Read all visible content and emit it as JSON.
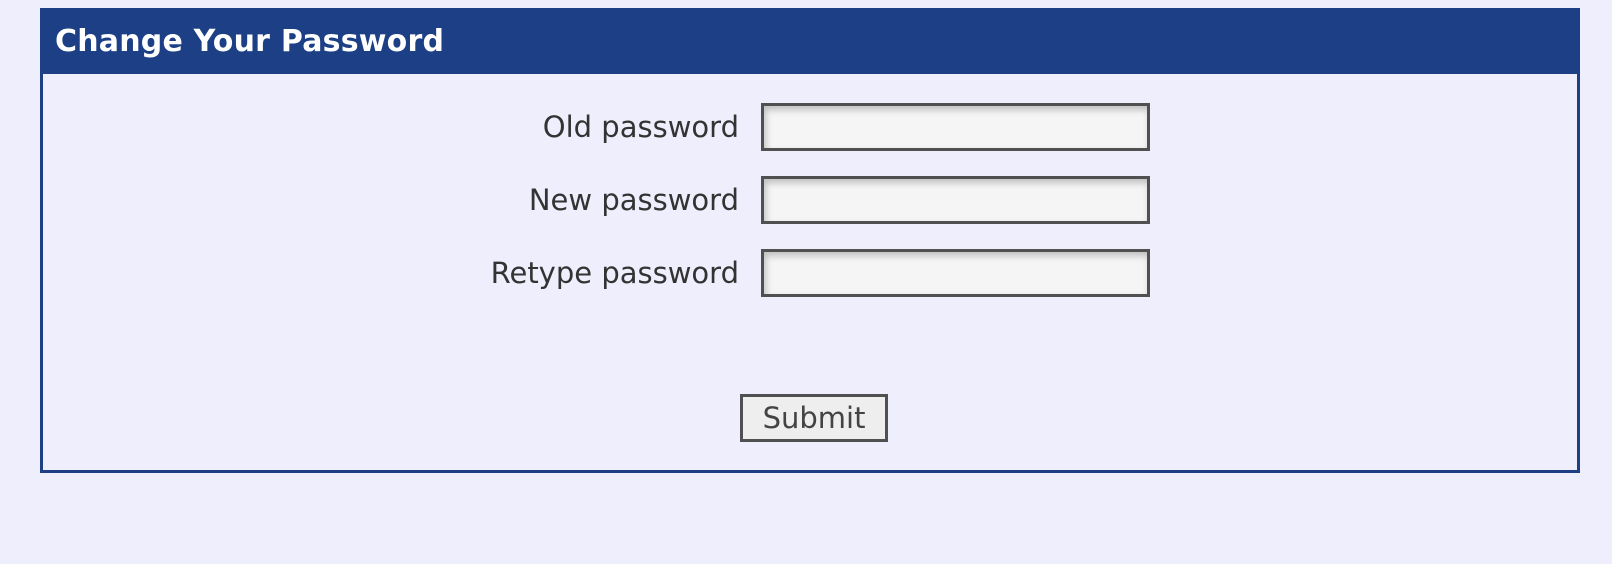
{
  "form": {
    "title": "Change Your Password",
    "fields": [
      {
        "label": "Old password",
        "value": "",
        "placeholder": ""
      },
      {
        "label": "New password",
        "value": "",
        "placeholder": ""
      },
      {
        "label": "Retype password",
        "value": "",
        "placeholder": ""
      }
    ],
    "submit_label": "Submit"
  },
  "colors": {
    "page_background": "#efeefd",
    "header_background": "#1c3f85",
    "header_text": "#ffffff",
    "label_text": "#333333",
    "input_border": "#505050",
    "input_background": "#f5f5f5",
    "button_background": "#eeeeee"
  }
}
